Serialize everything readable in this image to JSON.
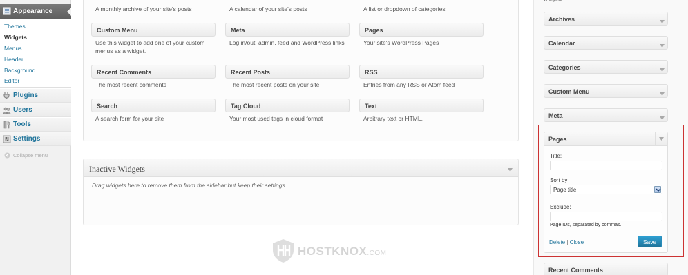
{
  "admin_menu": {
    "appearance": {
      "label": "Appearance",
      "icon": "appearance-icon"
    },
    "submenu": [
      {
        "label": "Themes"
      },
      {
        "label": "Widgets",
        "current": true
      },
      {
        "label": "Menus"
      },
      {
        "label": "Header"
      },
      {
        "label": "Background"
      },
      {
        "label": "Editor"
      }
    ],
    "items": [
      {
        "label": "Plugins",
        "icon": "plugins-icon"
      },
      {
        "label": "Users",
        "icon": "users-icon"
      },
      {
        "label": "Tools",
        "icon": "tools-icon"
      },
      {
        "label": "Settings",
        "icon": "settings-icon"
      }
    ],
    "collapse_label": "Collapse menu"
  },
  "available_widgets": [
    {
      "title": "",
      "desc": "A monthly archive of your site's posts"
    },
    {
      "title": "",
      "desc": "A calendar of your site's posts"
    },
    {
      "title": "",
      "desc": "A list or dropdown of categories"
    },
    {
      "title": "Custom Menu",
      "desc": "Use this widget to add one of your custom menus as a widget."
    },
    {
      "title": "Meta",
      "desc": "Log in/out, admin, feed and WordPress links"
    },
    {
      "title": "Pages",
      "desc": "Your site's WordPress Pages"
    },
    {
      "title": "Recent Comments",
      "desc": "The most recent comments"
    },
    {
      "title": "Recent Posts",
      "desc": "The most recent posts on your site"
    },
    {
      "title": "RSS",
      "desc": "Entries from any RSS or Atom feed"
    },
    {
      "title": "Search",
      "desc": "A search form for your site"
    },
    {
      "title": "Tag Cloud",
      "desc": "Your most used tags in cloud format"
    },
    {
      "title": "Text",
      "desc": "Arbitrary text or HTML."
    }
  ],
  "inactive": {
    "title": "Inactive Widgets",
    "description": "Drag widgets here to remove them from the sidebar but keep their settings."
  },
  "sidebar": {
    "label": "widgets",
    "widgets": [
      {
        "title": "Archives"
      },
      {
        "title": "Calendar"
      },
      {
        "title": "Categories"
      },
      {
        "title": "Custom Menu"
      },
      {
        "title": "Meta"
      }
    ],
    "after_widget": {
      "title": "Recent Comments"
    }
  },
  "pages_widget": {
    "title": "Pages",
    "title_label": "Title:",
    "title_value": "",
    "sortby_label": "Sort by:",
    "sortby_selected": "Page title",
    "exclude_label": "Exclude:",
    "exclude_value": "",
    "exclude_help": "Page IDs, separated by commas.",
    "delete_label": "Delete",
    "separator": "|",
    "close_label": "Close",
    "save_label": "Save"
  },
  "watermark": {
    "name": "HOSTKNOX",
    "tld": ".COM"
  },
  "colors": {
    "link": "#21759b",
    "save_button": "#21759b",
    "highlight": "#cc3333",
    "menu_active": "#6d6d6d"
  }
}
